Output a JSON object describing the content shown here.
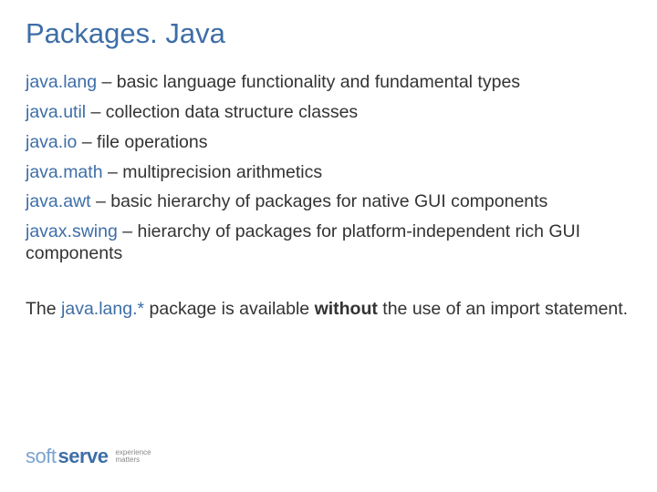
{
  "title": "Packages. Java",
  "packages": [
    {
      "name": "java.lang",
      "desc": " – basic language functionality and fundamental types"
    },
    {
      "name": "java.util",
      "desc": " – collection data structure classes"
    },
    {
      "name": "java.io",
      "desc": " – file operations"
    },
    {
      "name": "java.math",
      "desc": " – multiprecision arithmetics"
    },
    {
      "name": "java.awt",
      "desc": " – basic hierarchy of packages for native GUI components"
    },
    {
      "name": "javax.swing",
      "desc": " – hierarchy of packages for platform-independent rich GUI components"
    }
  ],
  "note": {
    "pre": "The ",
    "pkg": "java.lang.*",
    "mid": " package is available ",
    "bold": "without",
    "post": " the use of an import statement."
  },
  "logo": {
    "soft": "soft",
    "serve": "serve",
    "tag1": "experience",
    "tag2": "matters"
  }
}
